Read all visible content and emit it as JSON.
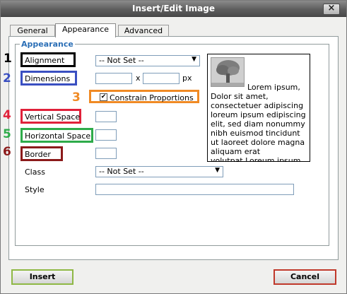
{
  "window": {
    "title": "Insert/Edit Image"
  },
  "tabs": [
    {
      "label": "General"
    },
    {
      "label": "Appearance"
    },
    {
      "label": "Advanced"
    }
  ],
  "fieldset": {
    "legend": "Appearance"
  },
  "annotations": [
    "1",
    "2",
    "3",
    "4",
    "5",
    "6"
  ],
  "fields": {
    "alignment": {
      "label": "Alignment",
      "value": "-- Not Set --"
    },
    "dimensions": {
      "label": "Dimensions",
      "width": "",
      "height": "",
      "separator": "x",
      "unit": "px"
    },
    "constrain": {
      "label": "Constrain Proportions",
      "checked": true
    },
    "vertical_space": {
      "label": "Vertical Space",
      "value": ""
    },
    "horizontal_space": {
      "label": "Horizontal Space",
      "value": ""
    },
    "border": {
      "label": "Border",
      "value": ""
    },
    "class": {
      "label": "Class",
      "value": "-- Not Set --"
    },
    "style": {
      "label": "Style",
      "value": ""
    }
  },
  "preview": {
    "text": "Lorem ipsum, Dolor sit amet, consectetuer adipiscing loreum ipsum edipiscing elit, sed diam nonummy nibh euismod tincidunt ut laoreet dolore magna aliquam erat volutpat.Loreum ipsum"
  },
  "buttons": {
    "insert": "Insert",
    "cancel": "Cancel"
  },
  "colors": {
    "num1": "#000000",
    "num2": "#3a4fc1",
    "num3": "#f08a24",
    "num4": "#e0213a",
    "num5": "#2eab4a",
    "num6": "#8b1a1a",
    "box_alignment": "#000000",
    "box_dimensions": "#3a4fc1",
    "box_vertical": "#e0213a",
    "box_horizontal": "#2eab4a",
    "box_border": "#8b1a1a",
    "insert_border": "#8fb845",
    "cancel_border": "#c0392b"
  }
}
